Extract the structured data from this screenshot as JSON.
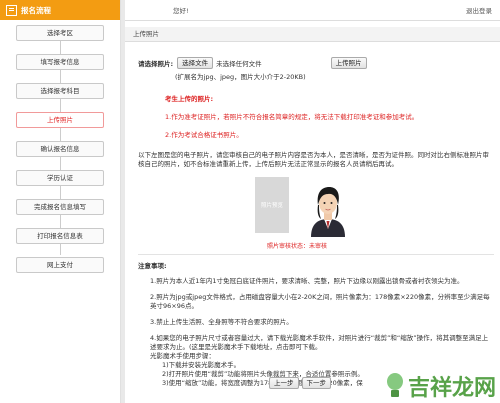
{
  "sidebar": {
    "header": "报名流程",
    "steps": [
      "选择考区",
      "填写报考信息",
      "选择报考科目",
      "上传照片",
      "确认报名信息",
      "学历认证",
      "完成报名信息填写",
      "打印报名信息表",
      "网上支付"
    ],
    "active_index": 3
  },
  "topbar": {
    "greeting": "您好!",
    "logout": "退出登录"
  },
  "panel": {
    "title": "上传照片"
  },
  "upload": {
    "label": "请选择照片:",
    "choose_button": "选择文件",
    "no_file": "未选择任何文件",
    "upload_button": "上传照片",
    "hint": "(扩展名为jpg、jpeg，图片大小介于2-20KB)"
  },
  "notice": {
    "title": "考生上传的照片:",
    "items": [
      "1.作为准考证照片，若照片不符合报名简章的规定，将无法下载打印准考证和参加考试。",
      "2.作为考试合格证书照片。"
    ]
  },
  "intro": "以下左图是您的电子照片，请您审核自己的电子照片内容是否为本人，是否清晰，是否为证件照。同时对比右侧标准照片审核自己的照片，如不合标准请重新上传，上传后照片无法正常显示的报名人员请稍后再试。",
  "photos": {
    "placeholder": "照片预览",
    "status": "照片审核状态：未审核"
  },
  "notes": {
    "title": "注意事项:",
    "items": [
      "1.照片为本人近1年内1寸免冠白底证件照片，要求清晰、完整，照片下边缘以刚露出锁骨或者衬衣领尖为准。",
      "2.照片为jpg或jpeg文件格式，占用磁盘容量大小在2-20K之间，照片像素为：178像素×220像素，分辨率至少满足每英寸96×96点。",
      "3.禁止上传生活照、全身照等不符合要求的照片。",
      "4.如果您的电子照片尺寸或者容量过大，请下载光影魔术手软件，对照片进行“裁剪”和“缩放”操作，将其调整至满足上述要求为止。(这里是光影魔术手下载地址，点击即可下载。"
    ],
    "tool_title": "光影魔术手使用步骤：",
    "tool_steps": [
      "1)下载并安装光影魔术手。",
      "2)打开照片使用“裁剪”功能将照片头像裁剪下来，合适位置参照示例。",
      "3)使用“缩放”功能，将宽度调整为178像素，高度调整为220像素，保"
    ]
  },
  "nav": {
    "prev": "上一步",
    "next": "下一步"
  },
  "watermark": "吉祥龙网"
}
